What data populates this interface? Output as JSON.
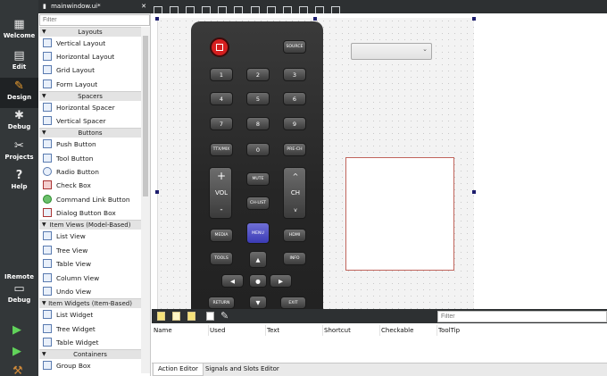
{
  "file_tab": {
    "label": "mainwindow.ui*"
  },
  "modes": [
    {
      "label": "Welcome",
      "icon": "grid-icon"
    },
    {
      "label": "Edit",
      "icon": "document-icon"
    },
    {
      "label": "Design",
      "icon": "pencil-icon"
    },
    {
      "label": "Debug",
      "icon": "bug-icon"
    },
    {
      "label": "Projects",
      "icon": "wrench-icon"
    },
    {
      "label": "Help",
      "icon": "help-icon"
    }
  ],
  "project": {
    "name": "IRemote",
    "config": "Debug"
  },
  "widget_box": {
    "filter_placeholder": "Filter",
    "categories": [
      "Layouts",
      "Spacers",
      "Buttons",
      "Item Views (Model-Based)",
      "Item Widgets (Item-Based)",
      "Containers"
    ],
    "layouts": [
      "Vertical Layout",
      "Horizontal Layout",
      "Grid Layout",
      "Form Layout"
    ],
    "spacers": [
      "Horizontal Spacer",
      "Vertical Spacer"
    ],
    "buttons": [
      "Push Button",
      "Tool Button",
      "Radio Button",
      "Check Box",
      "Command Link Button",
      "Dialog Button Box"
    ],
    "item_views": [
      "List View",
      "Tree View",
      "Table View",
      "Column View",
      "Undo View"
    ],
    "item_widgets": [
      "List Widget",
      "Tree Widget",
      "Table Widget"
    ],
    "containers": [
      "Group Box"
    ]
  },
  "remote": {
    "source": "SOURCE",
    "digits": [
      "1",
      "2",
      "3",
      "4",
      "5",
      "6",
      "7",
      "8",
      "9"
    ],
    "ttx": "TTX/MIX",
    "zero": "0",
    "prech": "PRE-CH",
    "vol": "VOL",
    "plus": "+",
    "minus": "-",
    "mute": "MUTE",
    "chlist": "CH-LIST",
    "ch": "CH",
    "up": "^",
    "down": "v",
    "media": "MEDIA",
    "menu": "MENU",
    "hdmi": "HDMI",
    "tools": "TOOLS",
    "info": "INFO",
    "arrow_up": "▲",
    "arrow_left": "◀",
    "arrow_ok": "●",
    "arrow_right": "▶",
    "arrow_down": "▼",
    "return": "RETURN",
    "exit": "EXIT"
  },
  "action_editor": {
    "filter_placeholder": "Filter",
    "columns": [
      "Name",
      "Used",
      "Text",
      "Shortcut",
      "Checkable",
      "ToolTip"
    ],
    "tabs": [
      "Action Editor",
      "Signals and Slots Editor"
    ]
  },
  "colors": {
    "power": "#d61f1f",
    "menu": "#4848c4",
    "run": "#61d35a"
  }
}
